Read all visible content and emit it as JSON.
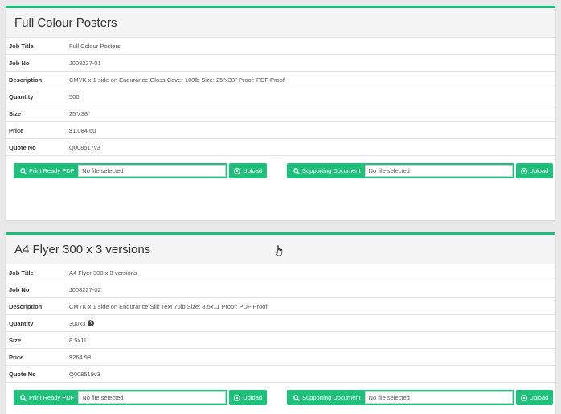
{
  "jobs": [
    {
      "title": "Full Colour Posters",
      "fields": [
        {
          "label": "Job Title",
          "value": "Full Colour Posters"
        },
        {
          "label": "Job No",
          "value": "J008227-01"
        },
        {
          "label": "Description",
          "value": "CMYK x 1 side on Endurance Gloss Cover 100lb Size: 25\"x38\" Proof: PDF Proof"
        },
        {
          "label": "Quantity",
          "value": "500"
        },
        {
          "label": "Size",
          "value": "25\"x38\""
        },
        {
          "label": "Price",
          "value": "$1,084.60"
        },
        {
          "label": "Quote No",
          "value": "Q008517v3"
        }
      ],
      "uploads": {
        "print_ready_label": "Print Ready PDF",
        "supporting_label": "Supporting Document",
        "file_placeholder": "No file selected",
        "upload_label": "Upload"
      }
    },
    {
      "title": "A4 Flyer 300 x 3 versions",
      "fields": [
        {
          "label": "Job Title",
          "value": "A4 Flyer 300 x 3 versions"
        },
        {
          "label": "Job No",
          "value": "J008227-02"
        },
        {
          "label": "Description",
          "value": "CMYK x 1 side on Endurance Silk Text 70lb Size: 8.5x11 Proof: PDF Proof"
        },
        {
          "label": "Quantity",
          "value": "300x3"
        },
        {
          "label": "Size",
          "value": "8.5x11"
        },
        {
          "label": "Price",
          "value": "$264.98"
        },
        {
          "label": "Quote No",
          "value": "Q008519v3"
        }
      ],
      "uploads": {
        "print_ready_label": "Print Ready PDF",
        "supporting_label": "Supporting Document",
        "file_placeholder": "No file selected",
        "upload_label": "Upload"
      }
    }
  ],
  "quantity_info_icon": "question-circle-icon",
  "colors": {
    "accent": "#1fbf7c",
    "panel_border": "#1abc7a",
    "background": "#e9e9e9"
  }
}
